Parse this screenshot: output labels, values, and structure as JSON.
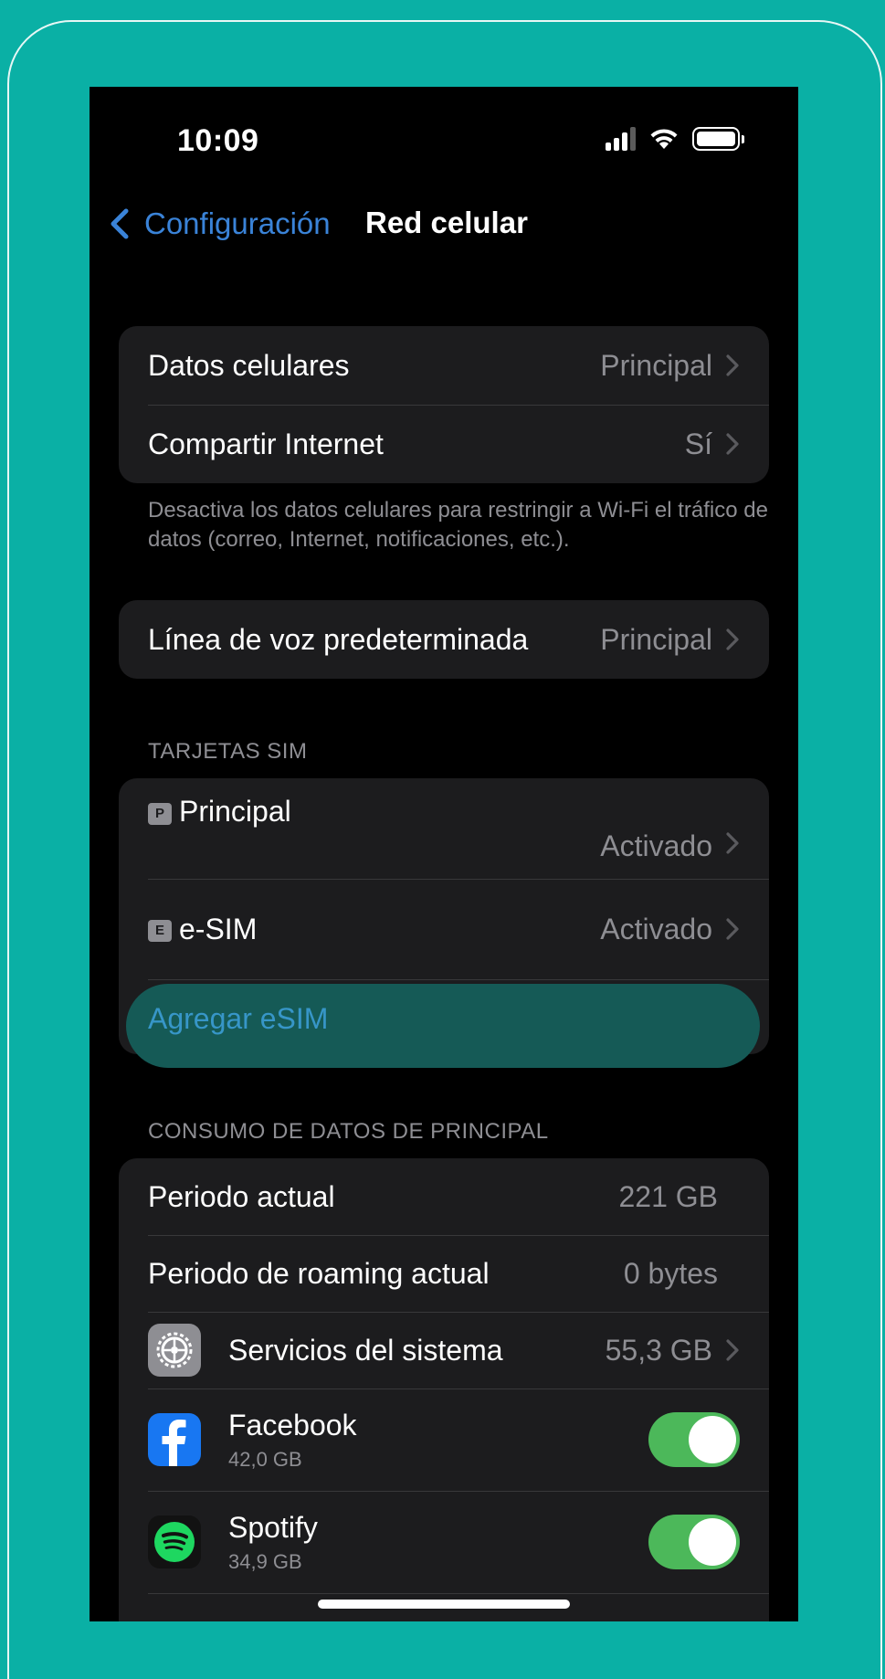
{
  "status_bar": {
    "time": "10:09"
  },
  "nav": {
    "back_label": "Configuración",
    "title": "Red celular"
  },
  "group1": {
    "rows": [
      {
        "label": "Datos celulares",
        "value": "Principal"
      },
      {
        "label": "Compartir Internet",
        "value": "Sí"
      }
    ],
    "footnote": "Desactiva los datos celulares para restringir a Wi-Fi el tráfico de datos (correo, Internet, notificaciones, etc.)."
  },
  "group2": {
    "label": "Línea de voz predeterminada",
    "value": "Principal"
  },
  "sim_section": {
    "header": "TARJETAS SIM",
    "sims": [
      {
        "badge": "P",
        "label": "Principal",
        "value": "Activado"
      },
      {
        "badge": "E",
        "label": "e-SIM",
        "value": "Activado"
      }
    ],
    "add_label": "Agregar eSIM"
  },
  "usage_section": {
    "header": "CONSUMO DE DATOS DE PRINCIPAL",
    "current_period": {
      "label": "Periodo actual",
      "value": "221 GB"
    },
    "roaming_period": {
      "label": "Periodo de roaming actual",
      "value": "0 bytes"
    },
    "system_services": {
      "label": "Servicios del sistema",
      "value": "55,3 GB",
      "icon": "gear-icon"
    },
    "apps": [
      {
        "name": "Facebook",
        "usage": "42,0 GB",
        "icon": "facebook-icon",
        "enabled": true
      },
      {
        "name": "Spotify",
        "usage": "34,9 GB",
        "icon": "spotify-icon",
        "enabled": true
      }
    ]
  },
  "colors": {
    "frame": "#0ab0a5",
    "accent_blue": "#3a83d8",
    "toggle_on": "#4cb85a"
  }
}
